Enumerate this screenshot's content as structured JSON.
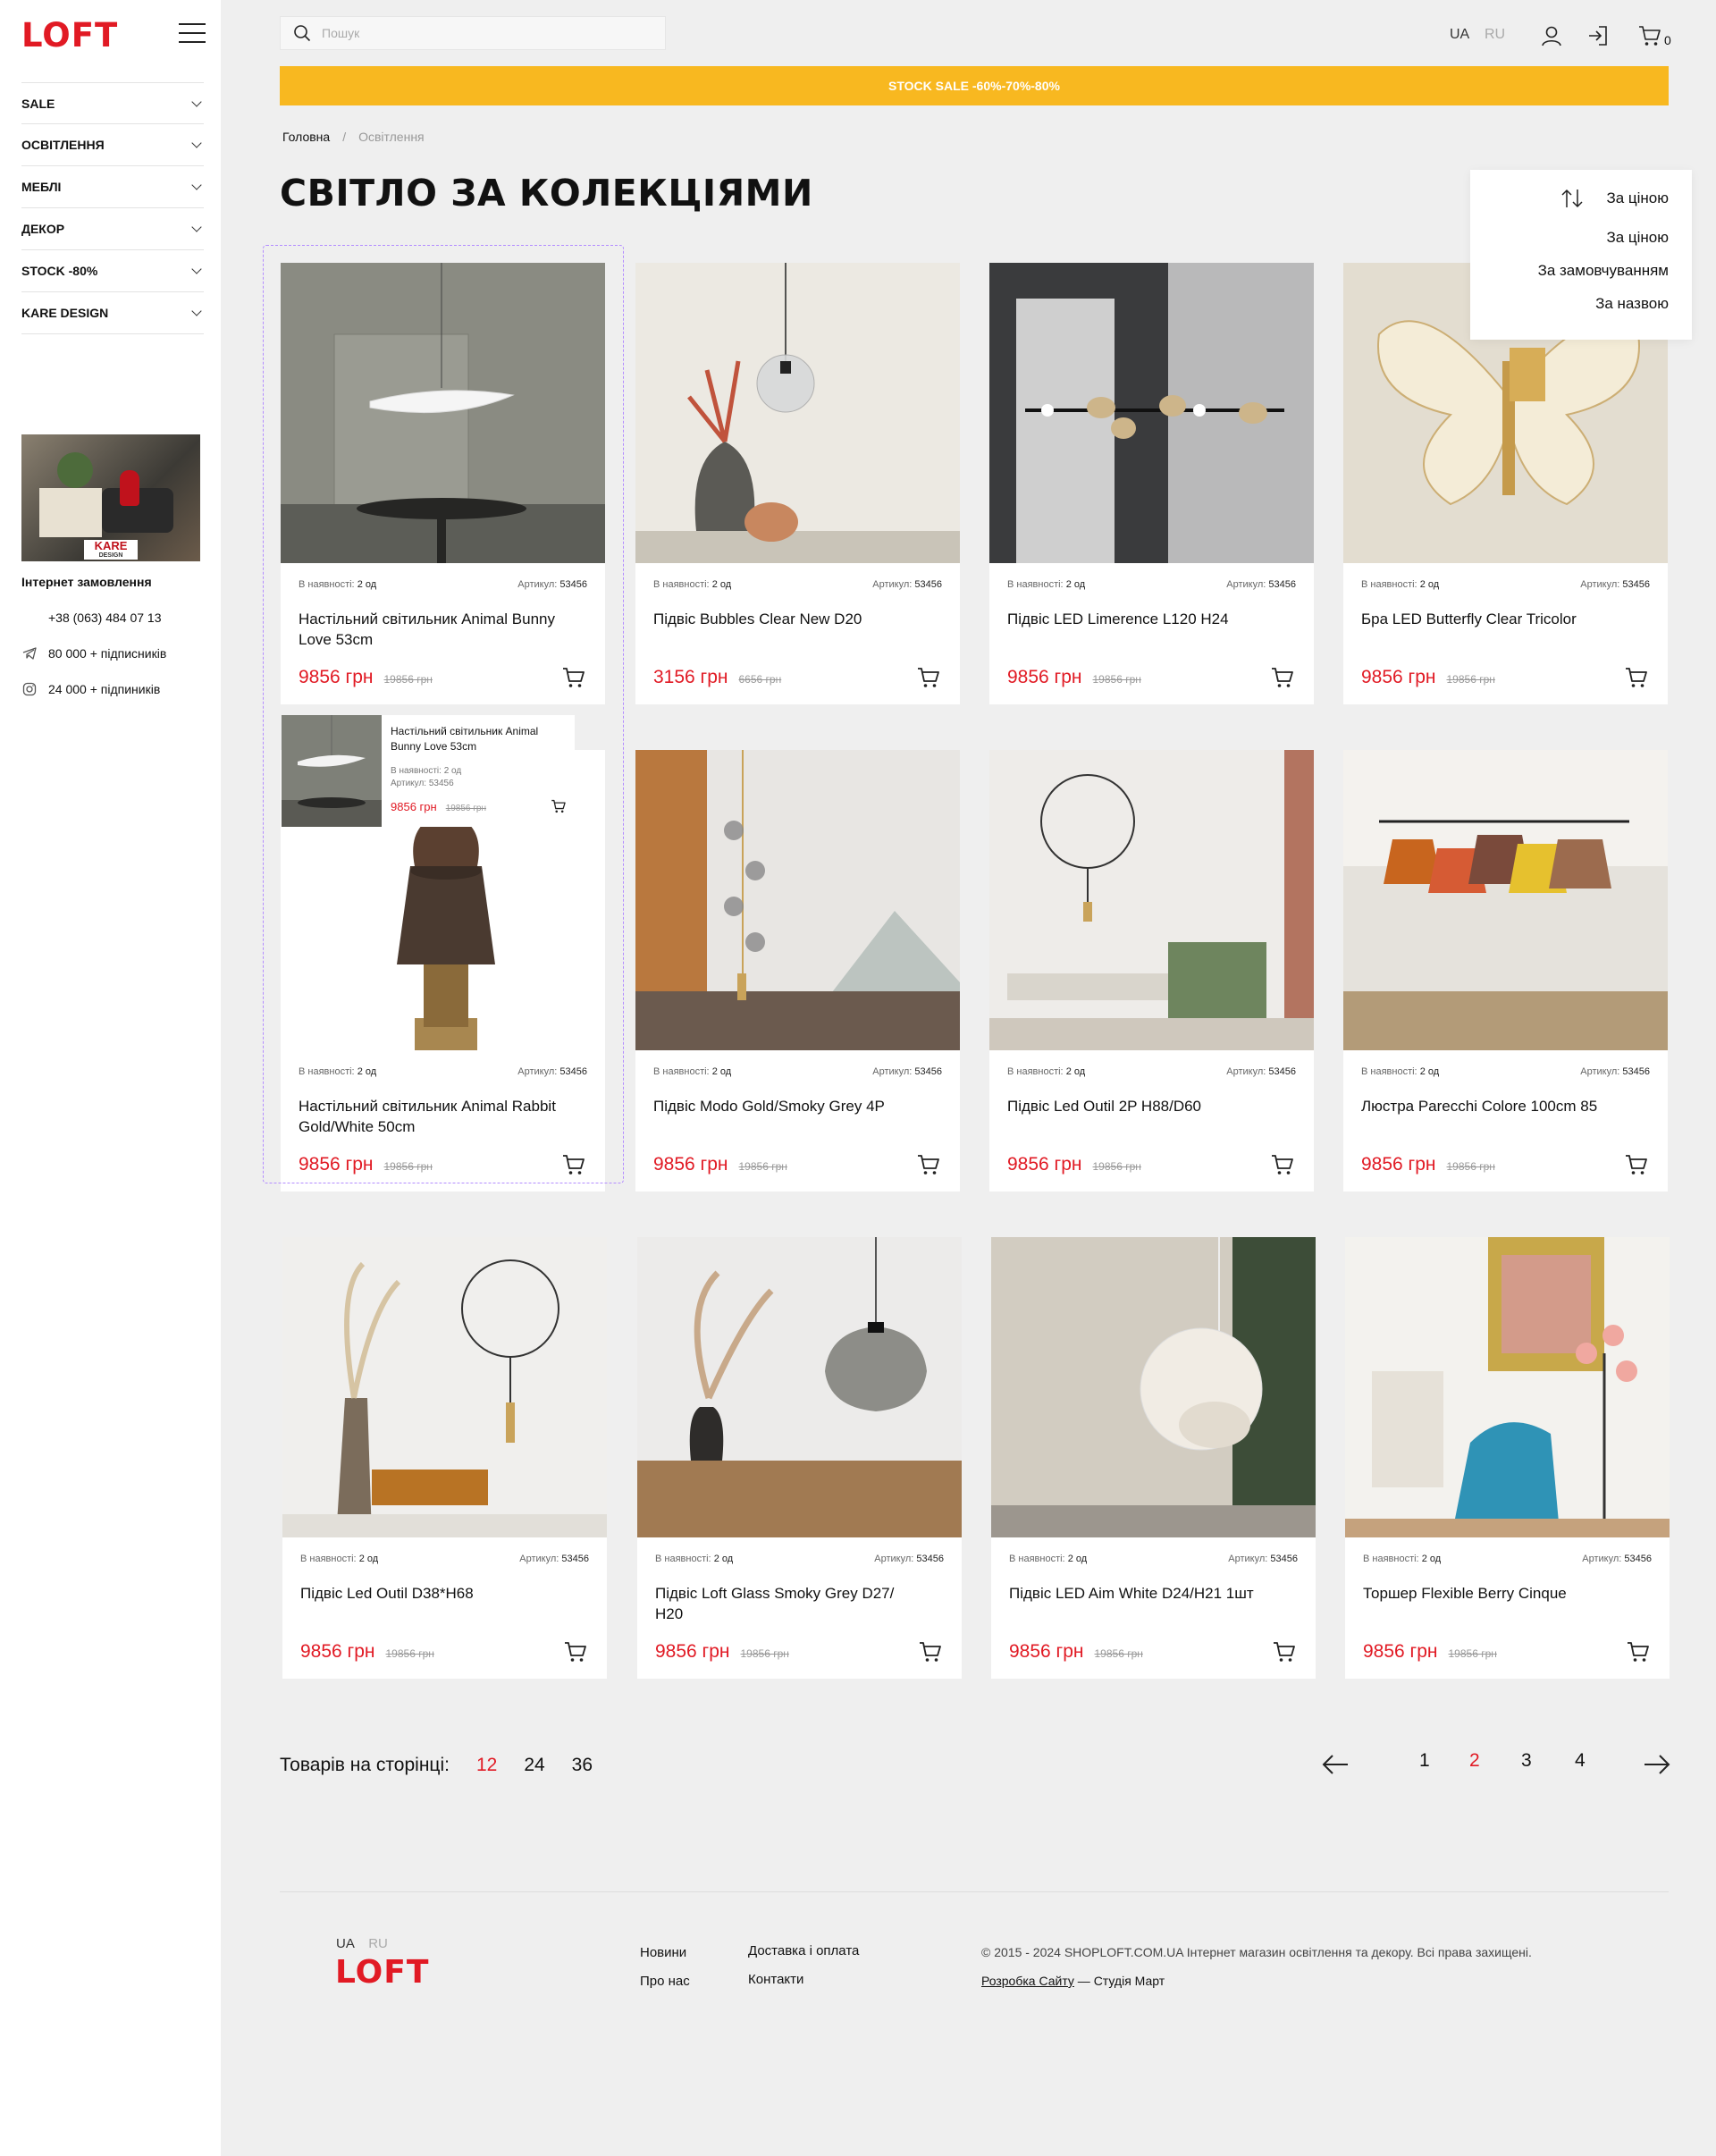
{
  "brand": {
    "logo": "LOFT",
    "color": "#e11a24"
  },
  "sidebar": {
    "items": [
      {
        "label": "SALE"
      },
      {
        "label": "ОСВІТЛЕННЯ"
      },
      {
        "label": "МЕБЛІ"
      },
      {
        "label": "ДЕКОР"
      },
      {
        "label": "STOCK -80%"
      },
      {
        "label": "KARE DESIGN"
      }
    ],
    "promo_label": "KARE",
    "promo_sub": "DESIGN",
    "title": "Інтернет замовлення",
    "phone": "+38 (063) 484 07 13",
    "telegram": "80 000 + підписників",
    "instagram": "24 000 + підпиників"
  },
  "header": {
    "search_placeholder": "Пошук",
    "lang_ua": "UA",
    "lang_ru": "RU",
    "cart_count": "0"
  },
  "banner": {
    "text": "STOCK SALE -60%-70%-80%",
    "color": "#f8b820"
  },
  "breadcrumb": {
    "home": "Головна",
    "sep": "/",
    "current": "Освітлення"
  },
  "page_title": "СВІТЛО ЗА КОЛЕКЦІЯМИ",
  "sort": {
    "current": "За ціною",
    "options": [
      "За ціною",
      "За замовчуванням",
      "За назвою"
    ]
  },
  "stock_label": "В наявності:",
  "stock_value": "2 од",
  "sku_label": "Артикул:",
  "sku_value": "53456",
  "products": [
    {
      "name": "Настільний світильник Animal Bunny Love 53cm",
      "price": "9856 грн",
      "old": "19856 грн"
    },
    {
      "name": "Підвіс Bubbles Clear New D20",
      "price": "3156 грн",
      "old": "6656 грн"
    },
    {
      "name": "Підвіс LED Limerence L120 H24",
      "price": "9856 грн",
      "old": "19856 грн"
    },
    {
      "name": "Бра LED Butterfly Clear Tricolor",
      "price": "9856 грн",
      "old": "19856 грн"
    },
    {
      "name": "Настільний світильник Animal Rabbit Gold/White 50cm",
      "price": "9856 грн",
      "old": "19856 грн"
    },
    {
      "name": "Підвіс Modo Gold/Smoky Grey 4P",
      "price": "9856 грн",
      "old": "19856 грн"
    },
    {
      "name": "Підвіс Led Outil 2P H88/D60",
      "price": "9856 грн",
      "old": "19856 грн"
    },
    {
      "name": "Люстра Parecchi Colore 100cm 85",
      "price": "9856 грн",
      "old": "19856 грн"
    },
    {
      "name": "Підвіс Led Outil D38*H68",
      "price": "9856 грн",
      "old": "19856 грн"
    },
    {
      "name": "Підвіс Loft Glass Smoky Grey D27/ H20",
      "price": "9856 грн",
      "old": "19856 грн"
    },
    {
      "name": "Підвіс LED Aim White D24/H21 1шт",
      "price": "9856 грн",
      "old": "19856 грн"
    },
    {
      "name": "Торшер Flexible Berry Cinque",
      "price": "9856 грн",
      "old": "19856 грн"
    }
  ],
  "hover_preview": {
    "name": "Настільний світильник Animal Bunny Love 53cm",
    "stock": "В наявності: 2 од",
    "sku": "Артикул: 53456",
    "price": "9856 грн",
    "old": "19856 грн"
  },
  "pagination": {
    "per_page_label": "Товарів на сторінці:",
    "per_page_options": [
      "12",
      "24",
      "36"
    ],
    "per_page_active": "12",
    "pages": [
      "1",
      "2",
      "3",
      "4"
    ],
    "current": "2"
  },
  "footer": {
    "lang_ua": "UA",
    "lang_ru": "RU",
    "logo": "LOFT",
    "links": [
      "Новини",
      "Про нас",
      "Доставка і оплата",
      "Контакти"
    ],
    "copyright": "© 2015 - 2024 SHOPLOFT.COM.UA Інтернет магазин освітлення та декору. Всі права захищені.",
    "dev_link": "Розробка Сайту",
    "dev_rest": " — Студія Март"
  }
}
